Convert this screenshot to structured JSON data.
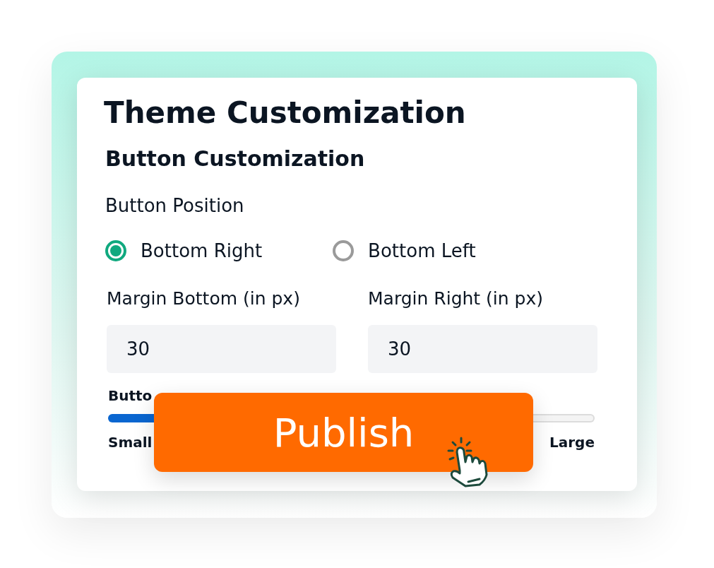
{
  "title": "Theme Customization",
  "section": "Button Customization",
  "position": {
    "label": "Button Position",
    "options": [
      {
        "label": "Bottom Right",
        "selected": true
      },
      {
        "label": "Bottom Left",
        "selected": false
      }
    ]
  },
  "margins": [
    {
      "label": "Margin Bottom (in px)",
      "value": "30"
    },
    {
      "label": "Margin Right (in px)",
      "value": "30"
    }
  ],
  "size": {
    "label": "Butto",
    "min_label": "Small",
    "max_label": "Large"
  },
  "publish_button": {
    "label": "Publish"
  }
}
